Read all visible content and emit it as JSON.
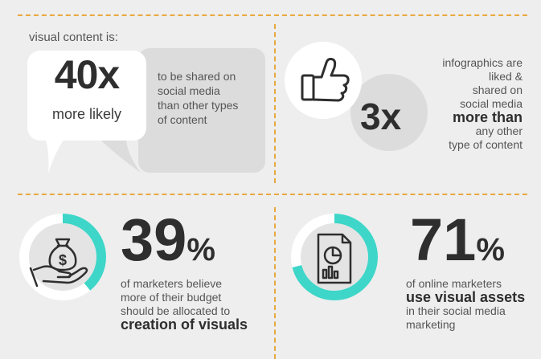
{
  "top_left": {
    "intro": "visual content is:",
    "big_number": "40x",
    "big_caption": "more likely",
    "detail_lines": [
      "to be shared on",
      "social media",
      "than other types",
      "of content"
    ]
  },
  "top_right": {
    "icon": "thumbs-up-icon",
    "big_number": "3x",
    "lines_before": [
      "infographics are",
      "liked &",
      "shared on",
      "social media"
    ],
    "emphasis": "more than",
    "lines_after": [
      "any other",
      "type of content"
    ]
  },
  "bottom_left": {
    "icon": "money-bag-hand-icon",
    "percent_value": "39",
    "percent_sign": "%",
    "ring_fraction": 0.39,
    "lines": [
      "of marketers believe",
      "more of their budget",
      "should be allocated to"
    ],
    "emphasis": "creation of visuals"
  },
  "bottom_right": {
    "icon": "report-chart-icon",
    "percent_value": "71",
    "percent_sign": "%",
    "ring_fraction": 0.71,
    "line_before": "of online marketers",
    "emphasis": "use visual assets",
    "lines_after": [
      "in their social media",
      "marketing"
    ]
  },
  "colors": {
    "accent_dashes": "#e8a93e",
    "ring_teal": "#3ed6c8",
    "ring_track": "#ffffff",
    "text_dark": "#2e2e2e",
    "bubble_grey": "#dcdcdc"
  }
}
